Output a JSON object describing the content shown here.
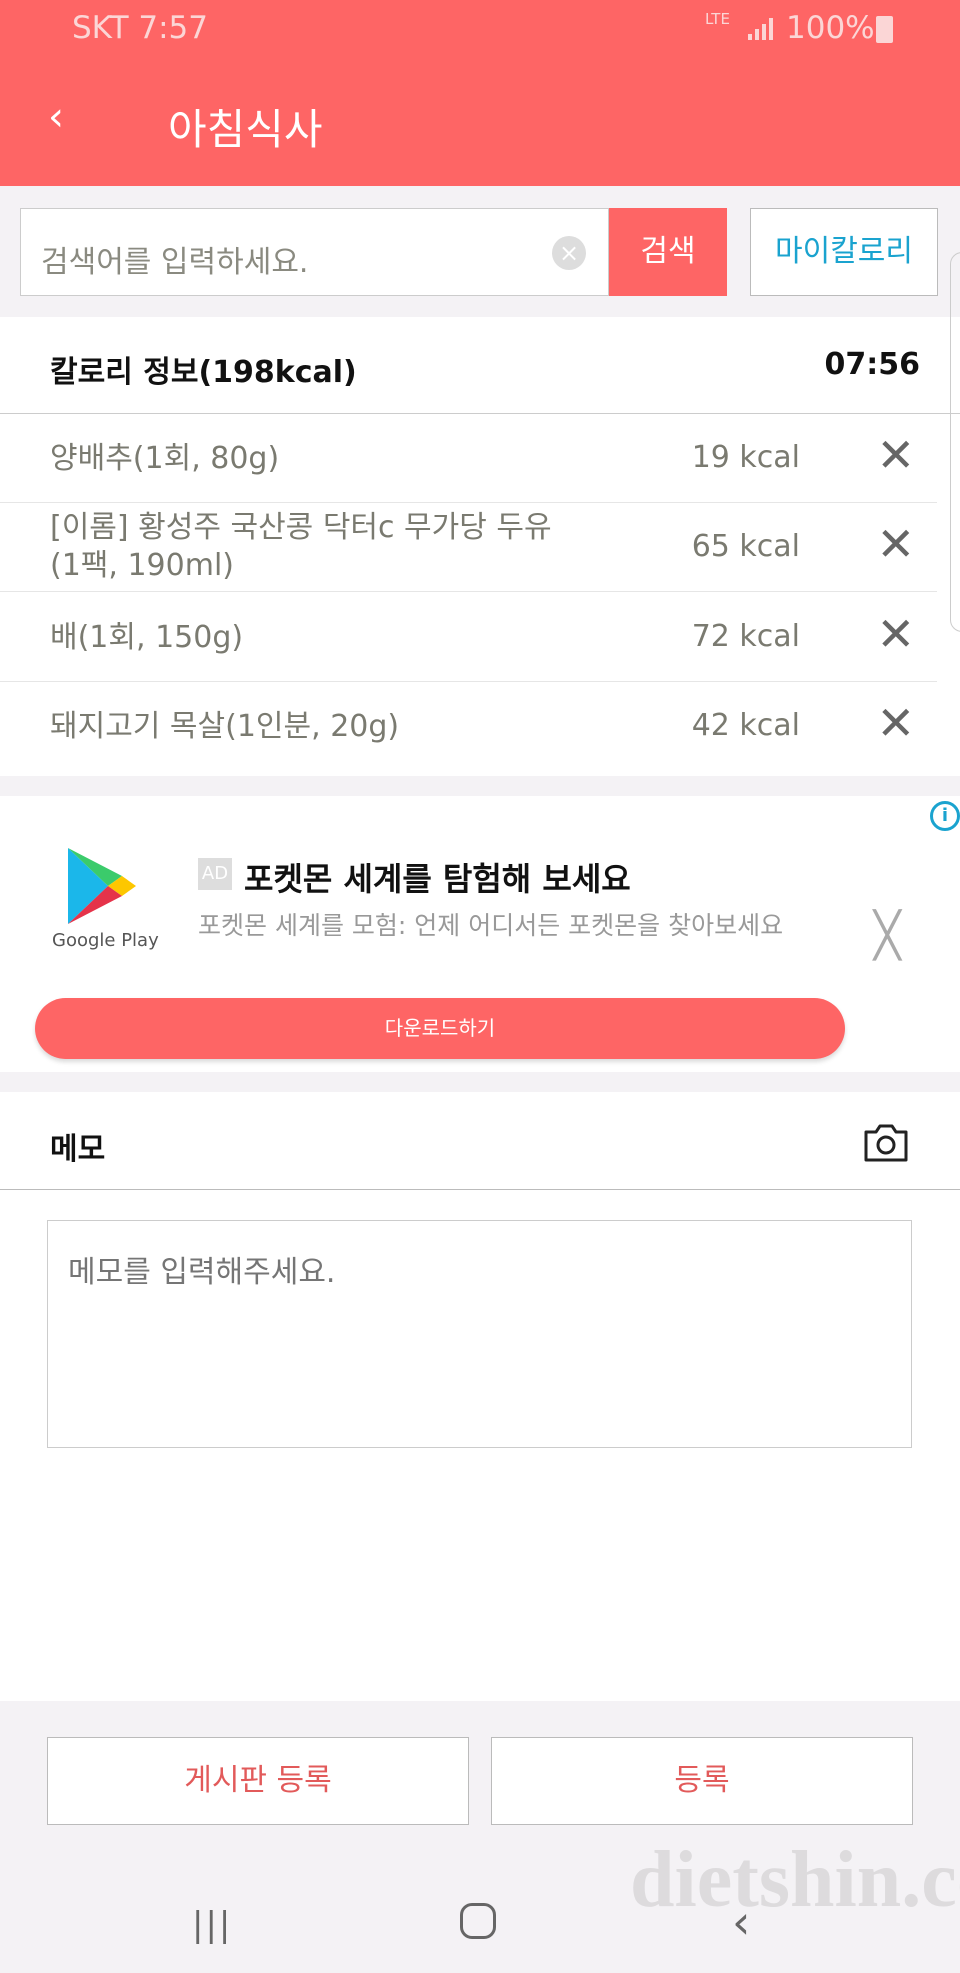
{
  "status_bar": {
    "carrier_time": "SKT 7:57",
    "network": "LTE",
    "battery": "100%"
  },
  "header": {
    "title": "아침식사",
    "back_icon": "chevron-left-icon"
  },
  "search": {
    "placeholder": "검색어를 입력하세요.",
    "button": "검색",
    "my_calorie": "마이칼로리"
  },
  "calorie": {
    "title": "칼로리 정보(198kcal)",
    "time": "07:56",
    "items": [
      {
        "name": "양배추(1회, 80g)",
        "kcal": "19 kcal"
      },
      {
        "name": "[이롬] 황성주 국산콩 닥터c 무가당 두유(1팩, 190ml)",
        "kcal": "65 kcal"
      },
      {
        "name": "배(1회, 150g)",
        "kcal": "72 kcal"
      },
      {
        "name": "돼지고기 목살(1인분, 20g)",
        "kcal": "42 kcal"
      }
    ]
  },
  "ad": {
    "badge": "AD",
    "logo_text": "Google Play",
    "title": "포켓몬 세계를 탐험해 보세요",
    "subtitle": "포켓몬 세계를 모험: 언제 어디서든 포켓몬을 찾아보세요",
    "cta": "다운로드하기"
  },
  "memo": {
    "title": "메모",
    "placeholder": "메모를 입력해주세요."
  },
  "actions": {
    "board": "게시판 등록",
    "register": "등록"
  },
  "watermark": "dietshin.com",
  "colors": {
    "accent": "#fe6565",
    "link": "#1aa3cf",
    "background": "#f4f2f5"
  }
}
